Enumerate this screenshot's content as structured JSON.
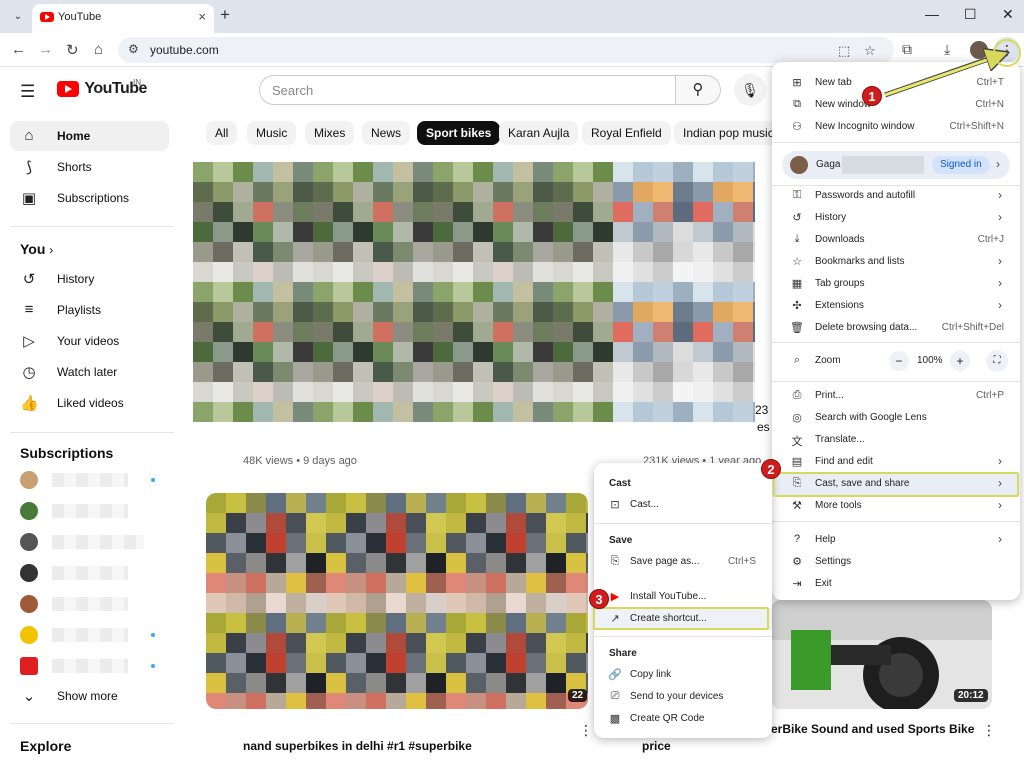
{
  "browser": {
    "tab_title": "YouTube",
    "url": "youtube.com",
    "new_tab_glyph": "+",
    "close_glyph": "×"
  },
  "youtube": {
    "logo_text": "YouTube",
    "country_code": "IN",
    "search_placeholder": "Search",
    "sidebar": {
      "main": [
        {
          "label": "Home",
          "icon": "home-icon"
        },
        {
          "label": "Shorts",
          "icon": "shorts-icon"
        },
        {
          "label": "Subscriptions",
          "icon": "subscriptions-icon"
        }
      ],
      "you_heading": "You",
      "you_items": [
        {
          "label": "History",
          "icon": "history-icon"
        },
        {
          "label": "Playlists",
          "icon": "playlists-icon"
        },
        {
          "label": "Your videos",
          "icon": "your-videos-icon"
        },
        {
          "label": "Watch later",
          "icon": "watch-later-icon"
        },
        {
          "label": "Liked videos",
          "icon": "liked-videos-icon"
        }
      ],
      "subscriptions_heading": "Subscriptions",
      "show_more": "Show more",
      "explore_heading": "Explore"
    },
    "chips": [
      "All",
      "Music",
      "Mixes",
      "News",
      "Sport bikes",
      "Karan Aujla",
      "Royal Enfield",
      "Indian pop music"
    ],
    "active_chip": "Sport bikes",
    "videos": [
      {
        "meta": "48K views • 9 days ago"
      },
      {
        "meta": "231K views • 1 year ago",
        "title_fragment": "23",
        "title_fragment2": "es"
      },
      {
        "title": "nand superbikes in delhi #r1 #superbike",
        "duration": "22"
      },
      {
        "title": "price"
      },
      {
        "title": "erBike Sound and used Sports Bike",
        "duration": "20:12"
      }
    ]
  },
  "chrome_menu": {
    "items_top": [
      {
        "label": "New tab",
        "shortcut": "Ctrl+T",
        "icon": "new-tab-icon"
      },
      {
        "label": "New window",
        "shortcut": "Ctrl+N",
        "icon": "new-window-icon"
      },
      {
        "label": "New Incognito window",
        "shortcut": "Ctrl+Shift+N",
        "icon": "incognito-icon"
      }
    ],
    "profile_name": "Gaga",
    "signed_in": "Signed in",
    "items_profile": [
      {
        "label": "Passwords and autofill",
        "icon": "key-icon"
      },
      {
        "label": "History",
        "icon": "history-icon"
      },
      {
        "label": "Downloads",
        "shortcut": "Ctrl+J",
        "icon": "download-icon"
      },
      {
        "label": "Bookmarks and lists",
        "icon": "star-icon"
      },
      {
        "label": "Tab groups",
        "icon": "tab-groups-icon"
      },
      {
        "label": "Extensions",
        "icon": "puzzle-icon"
      },
      {
        "label": "Delete browsing data...",
        "shortcut": "Ctrl+Shift+Del",
        "icon": "trash-icon"
      }
    ],
    "zoom_label": "Zoom",
    "zoom_value": "100%",
    "items_page": [
      {
        "label": "Print...",
        "shortcut": "Ctrl+P",
        "icon": "print-icon"
      },
      {
        "label": "Search with Google Lens",
        "icon": "lens-icon"
      },
      {
        "label": "Translate...",
        "icon": "translate-icon"
      },
      {
        "label": "Find and edit",
        "icon": "find-icon"
      },
      {
        "label": "Cast, save and share",
        "icon": "cast-save-icon"
      },
      {
        "label": "More tools",
        "icon": "tools-icon"
      }
    ],
    "items_bottom": [
      {
        "label": "Help",
        "icon": "help-icon"
      },
      {
        "label": "Settings",
        "icon": "settings-icon"
      },
      {
        "label": "Exit",
        "icon": "exit-icon"
      }
    ]
  },
  "submenu": {
    "cast_heading": "Cast",
    "cast_item": "Cast...",
    "save_heading": "Save",
    "save_page": "Save page as...",
    "save_shortcut": "Ctrl+S",
    "install": "Install YouTube...",
    "create_shortcut": "Create shortcut...",
    "share_heading": "Share",
    "copy_link": "Copy link",
    "send_devices": "Send to your devices",
    "qr_code": "Create QR Code"
  },
  "annotations": {
    "badge1": "1",
    "badge2": "2",
    "badge3": "3",
    "highlight_color": "#d8d85a",
    "badge_color": "#d01c1c"
  }
}
